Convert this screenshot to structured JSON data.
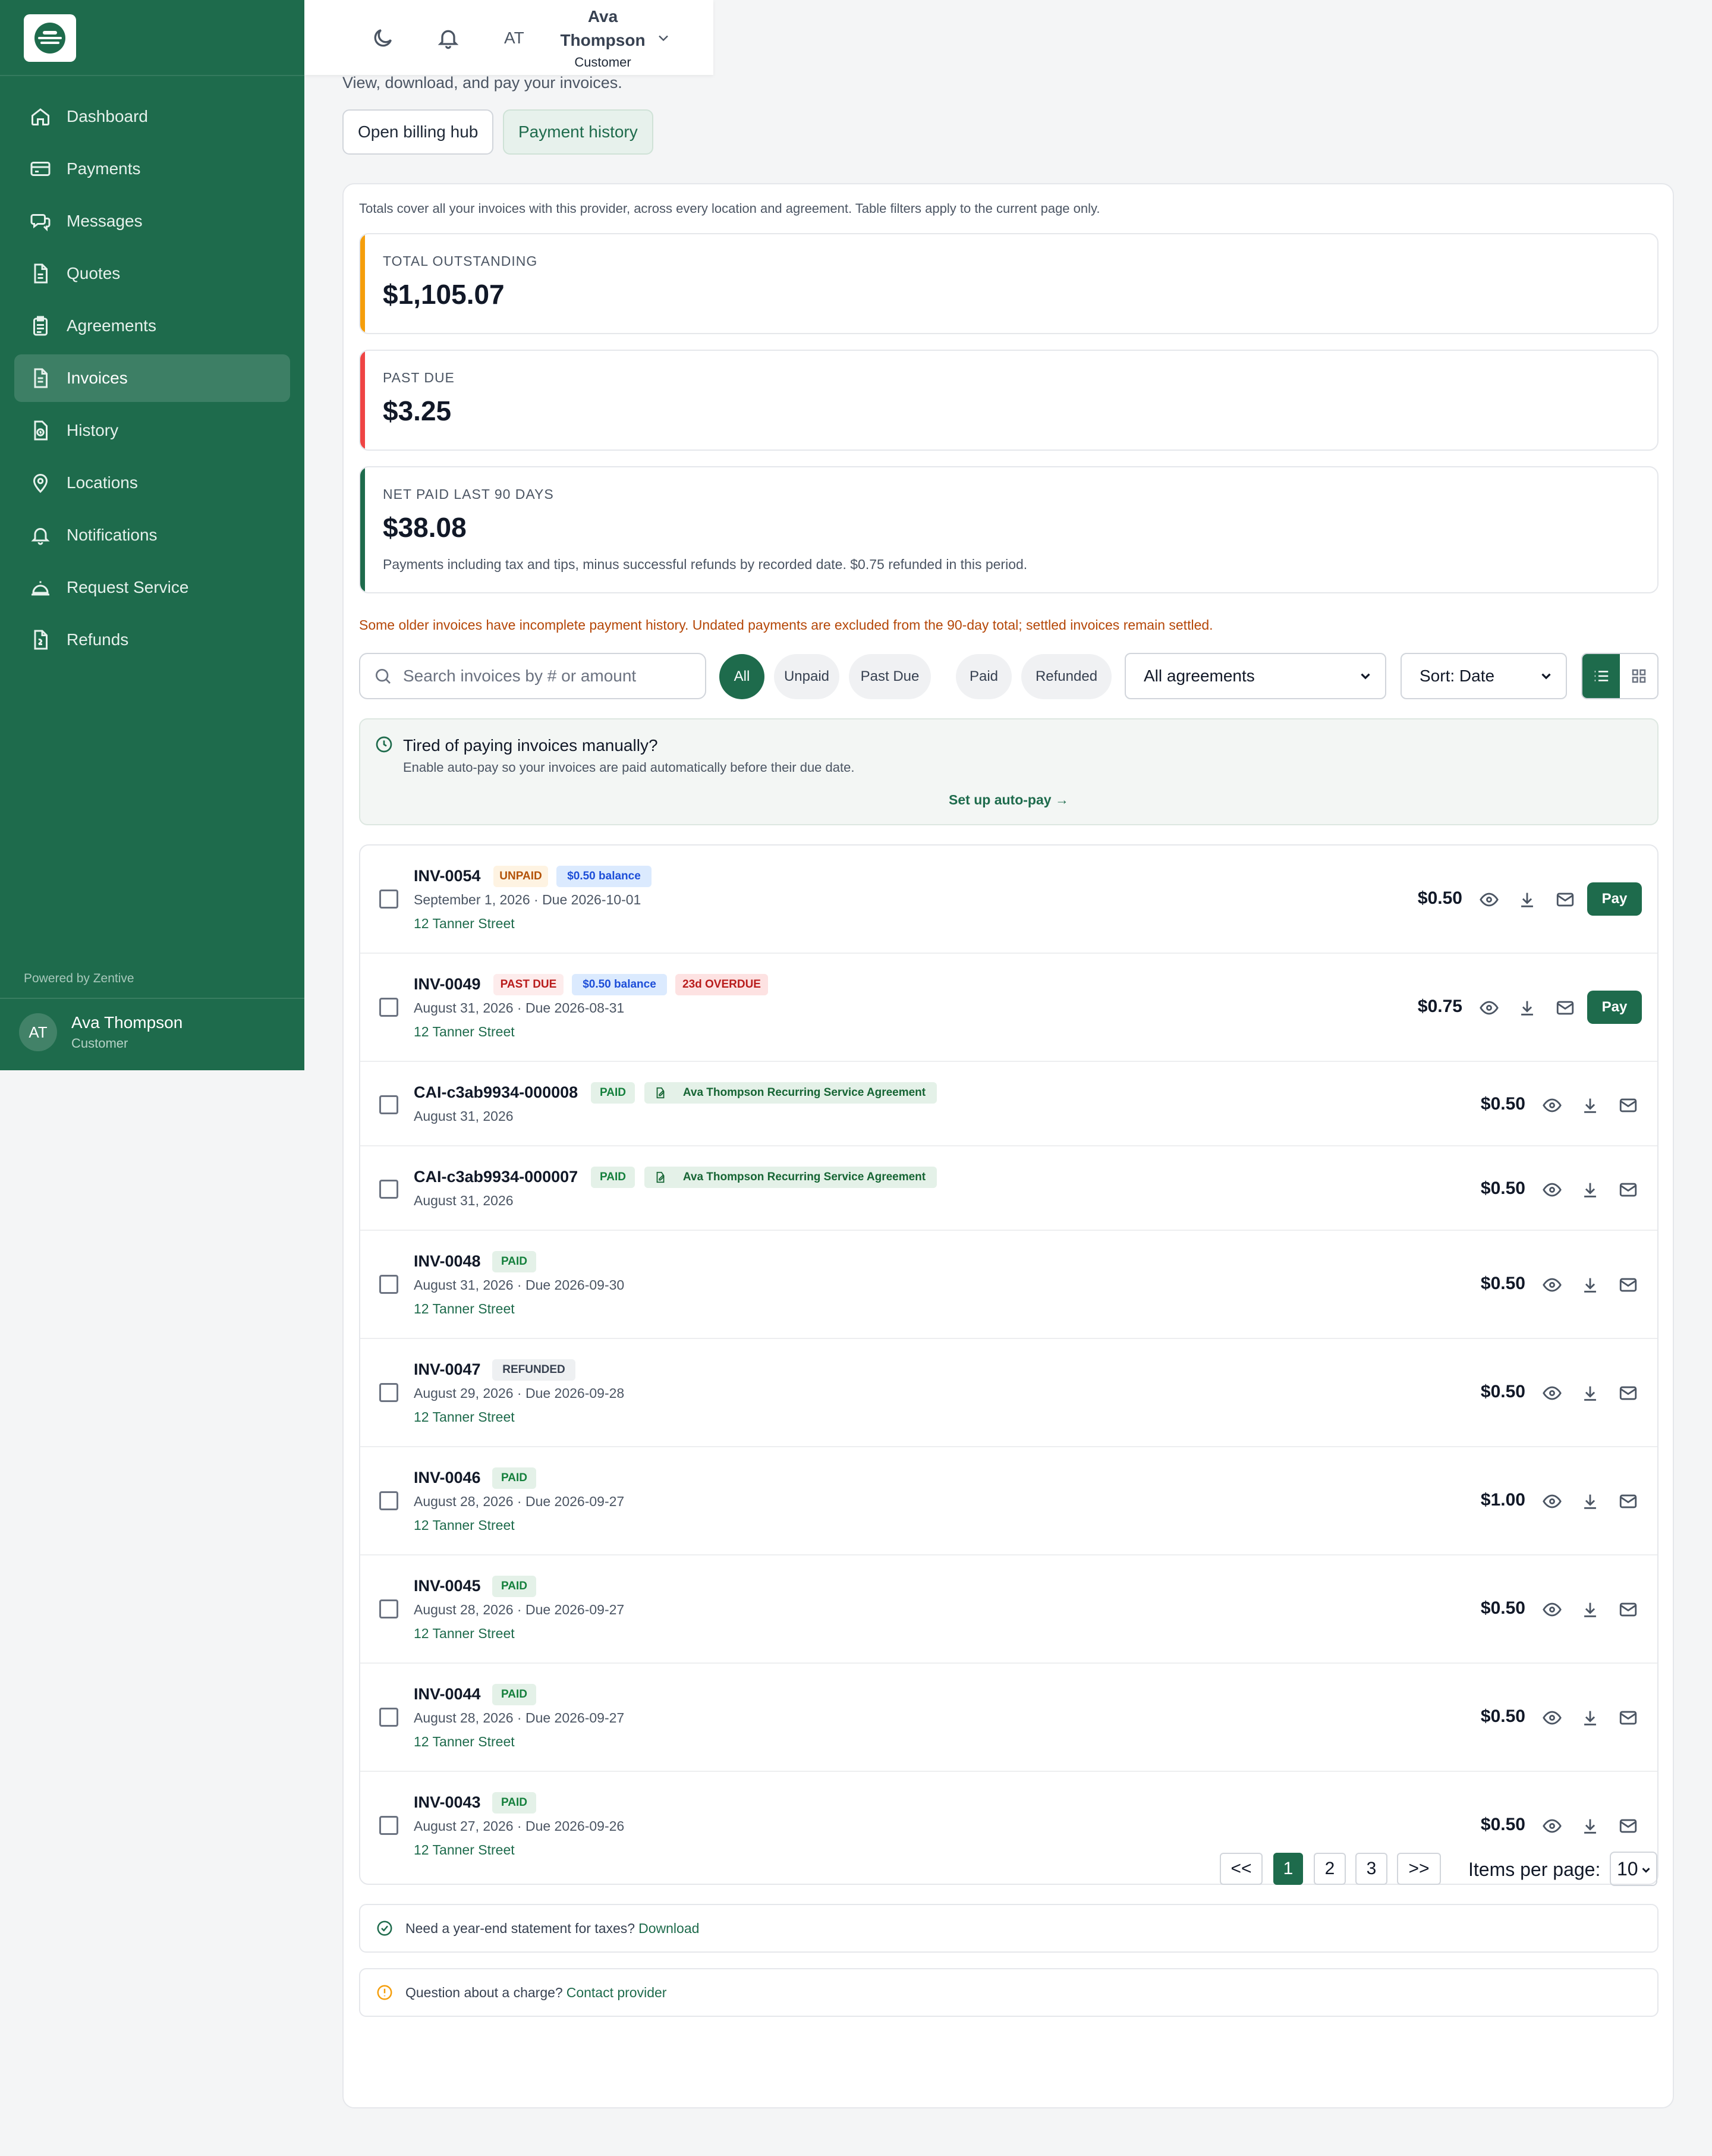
{
  "brand": {
    "accent": "#1e6b4c",
    "powered_by": "Powered by Zentive"
  },
  "sidebar": {
    "items": [
      {
        "label": "Dashboard",
        "icon": "home-icon"
      },
      {
        "label": "Payments",
        "icon": "credit-card-icon"
      },
      {
        "label": "Messages",
        "icon": "chat-icon"
      },
      {
        "label": "Quotes",
        "icon": "document-icon"
      },
      {
        "label": "Agreements",
        "icon": "clipboard-icon"
      },
      {
        "label": "Invoices",
        "icon": "invoice-icon",
        "active": true
      },
      {
        "label": "History",
        "icon": "history-icon"
      },
      {
        "label": "Locations",
        "icon": "map-pin-icon"
      },
      {
        "label": "Notifications",
        "icon": "bell-icon"
      },
      {
        "label": "Request Service",
        "icon": "service-bell-icon"
      },
      {
        "label": "Refunds",
        "icon": "refund-icon"
      }
    ],
    "user": {
      "initials": "AT",
      "name": "Ava Thompson",
      "role": "Customer"
    }
  },
  "topbar": {
    "initials": "AT",
    "name": "Ava Thompson",
    "role": "Customer"
  },
  "header": {
    "subtitle": "View, download, and pay your invoices.",
    "billing_hub": "Open billing hub",
    "payment_history": "Payment history"
  },
  "totals": {
    "note": "Totals cover all your invoices with this provider, across every location and agreement. Table filters apply to the current page only.",
    "outstanding": {
      "label": "TOTAL OUTSTANDING",
      "value": "$1,105.07",
      "color": "#f59e0b"
    },
    "past_due": {
      "label": "PAST DUE",
      "value": "$3.25",
      "color": "#ef4444"
    },
    "net_paid": {
      "label": "NET PAID LAST 90 DAYS",
      "value": "$38.08",
      "color": "#1e6b4c",
      "desc": "Payments including tax and tips, minus successful refunds by recorded date. $0.75 refunded in this period."
    },
    "warning": "Some older invoices have incomplete payment history. Undated payments are excluded from the 90-day total; settled invoices remain settled."
  },
  "filters": {
    "search_placeholder": "Search invoices by # or amount",
    "chips": [
      "All",
      "Unpaid",
      "Past Due",
      "Paid",
      "Refunded"
    ],
    "agreement_select": "All agreements",
    "sort_select": "Sort: Date"
  },
  "autopay": {
    "title": "Tired of paying invoices manually?",
    "desc": "Enable auto-pay so your invoices are paid automatically before their due date.",
    "link": "Set up auto-pay →"
  },
  "invoices": [
    {
      "id": "INV-0054",
      "status": "UNPAID",
      "balance": "$0.50 balance",
      "date": "September 1, 2026 · Due 2026-10-01",
      "location": "12 Tanner Street",
      "amount": "$0.50",
      "pay": "Pay"
    },
    {
      "id": "INV-0049",
      "status": "PAST DUE",
      "balance": "$0.50 balance",
      "overdue": "23d OVERDUE",
      "date": "August 31, 2026 · Due 2026-08-31",
      "location": "12 Tanner Street",
      "amount": "$0.75",
      "pay": "Pay"
    },
    {
      "id": "CAI-c3ab9934-000008",
      "status": "PAID",
      "agreement": "Ava Thompson Recurring Service Agreement",
      "date": "August 31, 2026",
      "amount": "$0.50"
    },
    {
      "id": "CAI-c3ab9934-000007",
      "status": "PAID",
      "agreement": "Ava Thompson Recurring Service Agreement",
      "date": "August 31, 2026",
      "amount": "$0.50"
    },
    {
      "id": "INV-0048",
      "status": "PAID",
      "date": "August 31, 2026 · Due 2026-09-30",
      "location": "12 Tanner Street",
      "amount": "$0.50"
    },
    {
      "id": "INV-0047",
      "status": "REFUNDED",
      "date": "August 29, 2026 · Due 2026-09-28",
      "location": "12 Tanner Street",
      "amount": "$0.50"
    },
    {
      "id": "INV-0046",
      "status": "PAID",
      "date": "August 28, 2026 · Due 2026-09-27",
      "location": "12 Tanner Street",
      "amount": "$1.00"
    },
    {
      "id": "INV-0045",
      "status": "PAID",
      "date": "August 28, 2026 · Due 2026-09-27",
      "location": "12 Tanner Street",
      "amount": "$0.50"
    },
    {
      "id": "INV-0044",
      "status": "PAID",
      "date": "August 28, 2026 · Due 2026-09-27",
      "location": "12 Tanner Street",
      "amount": "$0.50"
    },
    {
      "id": "INV-0043",
      "status": "PAID",
      "date": "August 27, 2026 · Due 2026-09-26",
      "location": "12 Tanner Street",
      "amount": "$0.50"
    }
  ],
  "footer": {
    "tax_text": "Need a year-end statement for taxes?",
    "tax_link": "Download",
    "question_text": "Question about a charge?",
    "question_link": "Contact provider"
  },
  "pagination": {
    "first": "<<",
    "pages": [
      "1",
      "2",
      "3"
    ],
    "last": ">>",
    "items_label": "Items per page:",
    "items_value": "10"
  }
}
